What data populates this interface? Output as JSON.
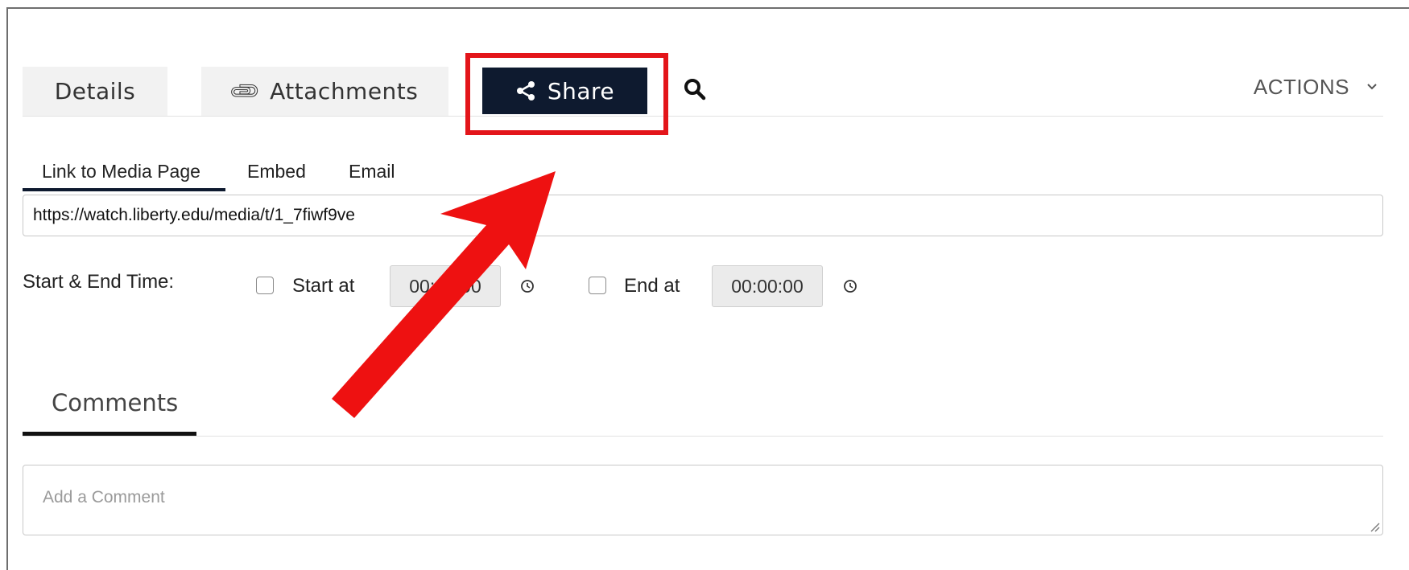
{
  "tabs": {
    "details": "Details",
    "attachments": "Attachments",
    "share": "Share"
  },
  "actions_label": "ACTIONS",
  "share_subtabs": {
    "link": "Link to Media Page",
    "embed": "Embed",
    "email": "Email"
  },
  "link_url": "https://watch.liberty.edu/media/t/1_7fiwf9ve",
  "start_end": {
    "label": "Start & End Time:",
    "start_label": "Start at",
    "start_value": "00:00:00",
    "end_label": "End at",
    "end_value": "00:00:00"
  },
  "comments": {
    "tab_label": "Comments",
    "placeholder": "Add a Comment"
  },
  "icons": {
    "attachments": "paperclip-icon",
    "share": "share-icon",
    "search": "search-icon",
    "actions": "chevron-down-icon",
    "time": "clock-icon",
    "annotation": "red-arrow"
  },
  "colors": {
    "active_tab_bg": "#0e1a2f",
    "highlight": "#e3151a",
    "arrow": "#ee1111"
  }
}
